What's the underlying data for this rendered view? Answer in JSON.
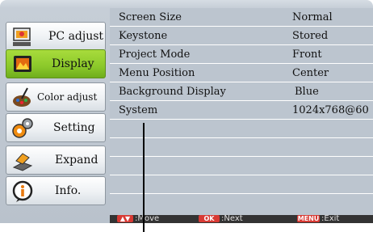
{
  "sidebar": {
    "items": [
      {
        "label": "PC adjust",
        "icon": "pc-adjust-icon",
        "active": false
      },
      {
        "label": "Display",
        "icon": "display-icon",
        "active": true
      },
      {
        "label": "Color adjust",
        "icon": "color-adjust-icon",
        "active": false
      },
      {
        "label": "Setting",
        "icon": "gears-icon",
        "active": false
      },
      {
        "label": "Expand",
        "icon": "expand-icon",
        "active": false
      },
      {
        "label": "Info.",
        "icon": "info-icon",
        "active": false
      }
    ]
  },
  "menu": {
    "rows": [
      {
        "label": "Screen Size",
        "value": "Normal"
      },
      {
        "label": "Keystone",
        "value": "Stored"
      },
      {
        "label": "Project Mode",
        "value": "Front"
      },
      {
        "label": "Menu Position",
        "value": "Center"
      },
      {
        "label": "Background Display",
        "value": "Blue"
      },
      {
        "label": "System",
        "value": "1024x768@60"
      }
    ]
  },
  "footer": {
    "move_label": ":Move",
    "ok_key": "OK",
    "next_label": ":Next",
    "menu_key": "MENU",
    "exit_label": ":Exit"
  },
  "colors": {
    "active_button": "#8bc82a",
    "panel": "#bcc5cf",
    "footer": "#333333",
    "key_badge": "#d83a34"
  }
}
